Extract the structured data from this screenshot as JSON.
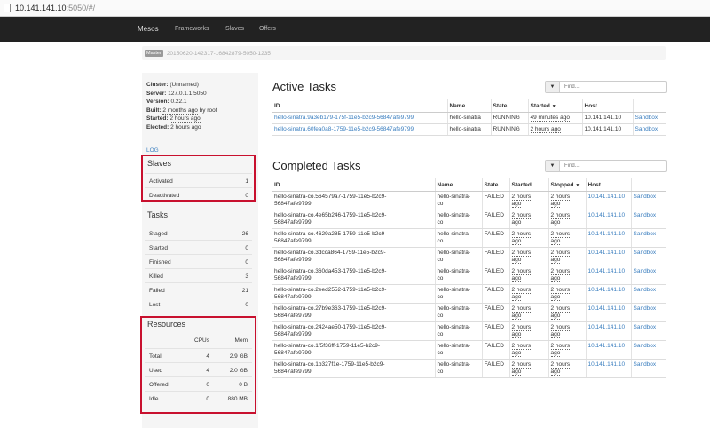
{
  "browser": {
    "url_host": "10.141.141.10",
    "url_rest": ":5050/#/"
  },
  "nav": {
    "brand": "Mesos",
    "items": [
      "Frameworks",
      "Slaves",
      "Offers"
    ]
  },
  "breadcrumb": {
    "badge": "Master",
    "id": "20150620-142317-16842879-5050-1235"
  },
  "cluster": {
    "cluster_label": "Cluster:",
    "cluster_value": "(Unnamed)",
    "server_label": "Server:",
    "server_value": "127.0.1.1:5050",
    "version_label": "Version:",
    "version_value": "0.22.1",
    "built_label": "Built:",
    "built_value": "2 months ago",
    "built_by": "by root",
    "started_label": "Started:",
    "started_value": "2 hours ago",
    "elected_label": "Elected:",
    "elected_value": "2 hours ago",
    "log_link": "LOG"
  },
  "slaves": {
    "title": "Slaves",
    "rows": [
      {
        "label": "Activated",
        "value": "1"
      },
      {
        "label": "Deactivated",
        "value": "0"
      }
    ]
  },
  "tasks_summary": {
    "title": "Tasks",
    "rows": [
      {
        "label": "Staged",
        "value": "26"
      },
      {
        "label": "Started",
        "value": "0"
      },
      {
        "label": "Finished",
        "value": "0"
      },
      {
        "label": "Killed",
        "value": "3"
      },
      {
        "label": "Failed",
        "value": "21"
      },
      {
        "label": "Lost",
        "value": "0"
      }
    ]
  },
  "resources": {
    "title": "Resources",
    "col_cpus": "CPUs",
    "col_mem": "Mem",
    "rows": [
      {
        "label": "Total",
        "cpus": "4",
        "mem": "2.9 GB"
      },
      {
        "label": "Used",
        "cpus": "4",
        "mem": "2.0 GB"
      },
      {
        "label": "Offered",
        "cpus": "0",
        "mem": "0 B"
      },
      {
        "label": "Idle",
        "cpus": "0",
        "mem": "880 MB"
      }
    ]
  },
  "active_tasks": {
    "title": "Active Tasks",
    "filter_placeholder": "Find...",
    "headers": {
      "id": "ID",
      "name": "Name",
      "state": "State",
      "started": "Started",
      "host": "Host"
    },
    "rows": [
      {
        "id": "hello-sinatra.9a3eb179-175f-11e5-b2c9-56847afe9799",
        "name": "hello-sinatra",
        "state": "RUNNING",
        "started": "49 minutes ago",
        "host": "10.141.141.10",
        "sandbox": "Sandbox"
      },
      {
        "id": "hello-sinatra.60fea0a8-1759-11e5-b2c9-56847afe9799",
        "name": "hello-sinatra",
        "state": "RUNNING",
        "started": "2 hours ago",
        "host": "10.141.141.10",
        "sandbox": "Sandbox"
      }
    ]
  },
  "completed_tasks": {
    "title": "Completed Tasks",
    "filter_placeholder": "Find...",
    "headers": {
      "id": "ID",
      "name": "Name",
      "state": "State",
      "started": "Started",
      "stopped": "Stopped",
      "host": "Host"
    },
    "rows": [
      {
        "id1": "hello-sinatra-co.564579a7-1759-11e5-b2c9-",
        "id2": "56847afe9799",
        "name1": "hello-sinatra-",
        "name2": "co",
        "state": "FAILED",
        "started1": "2 hours",
        "started2": "ago",
        "stopped1": "2 hours",
        "stopped2": "ago",
        "host": "10.141.141.10",
        "sandbox": "Sandbox"
      },
      {
        "id1": "hello-sinatra-co.4e65b246-1759-11e5-b2c9-",
        "id2": "56847afe9799",
        "name1": "hello-sinatra-",
        "name2": "co",
        "state": "FAILED",
        "started1": "2 hours",
        "started2": "ago",
        "stopped1": "2 hours",
        "stopped2": "ago",
        "host": "10.141.141.10",
        "sandbox": "Sandbox"
      },
      {
        "id1": "hello-sinatra-co.4629a285-1759-11e5-b2c9-",
        "id2": "56847afe9799",
        "name1": "hello-sinatra-",
        "name2": "co",
        "state": "FAILED",
        "started1": "2 hours",
        "started2": "ago",
        "stopped1": "2 hours",
        "stopped2": "ago",
        "host": "10.141.141.10",
        "sandbox": "Sandbox"
      },
      {
        "id1": "hello-sinatra-co.3dcca864-1759-11e5-b2c9-",
        "id2": "56847afe9799",
        "name1": "hello-sinatra-",
        "name2": "co",
        "state": "FAILED",
        "started1": "2 hours",
        "started2": "ago",
        "stopped1": "2 hours",
        "stopped2": "ago",
        "host": "10.141.141.10",
        "sandbox": "Sandbox"
      },
      {
        "id1": "hello-sinatra-co.360da453-1759-11e5-b2c9-",
        "id2": "56847afe9799",
        "name1": "hello-sinatra-",
        "name2": "co",
        "state": "FAILED",
        "started1": "2 hours",
        "started2": "ago",
        "stopped1": "2 hours",
        "stopped2": "ago",
        "host": "10.141.141.10",
        "sandbox": "Sandbox"
      },
      {
        "id1": "hello-sinatra-co.2eed2552-1759-11e5-b2c9-",
        "id2": "56847afe9799",
        "name1": "hello-sinatra-",
        "name2": "co",
        "state": "FAILED",
        "started1": "2 hours",
        "started2": "ago",
        "stopped1": "2 hours",
        "stopped2": "ago",
        "host": "10.141.141.10",
        "sandbox": "Sandbox"
      },
      {
        "id1": "hello-sinatra-co.27b9e363-1759-11e5-b2c9-",
        "id2": "56847afe9799",
        "name1": "hello-sinatra-",
        "name2": "co",
        "state": "FAILED",
        "started1": "2 hours",
        "started2": "ago",
        "stopped1": "2 hours",
        "stopped2": "ago",
        "host": "10.141.141.10",
        "sandbox": "Sandbox"
      },
      {
        "id1": "hello-sinatra-co.2424ae50-1759-11e5-b2c9-",
        "id2": "56847afe9799",
        "name1": "hello-sinatra-",
        "name2": "co",
        "state": "FAILED",
        "started1": "2 hours",
        "started2": "ago",
        "stopped1": "2 hours",
        "stopped2": "ago",
        "host": "10.141.141.10",
        "sandbox": "Sandbox"
      },
      {
        "id1": "hello-sinatra-co.1f5f36ff-1759-11e5-b2c9-",
        "id2": "56847afe9799",
        "name1": "hello-sinatra-",
        "name2": "co",
        "state": "FAILED",
        "started1": "2 hours",
        "started2": "ago",
        "stopped1": "2 hours",
        "stopped2": "ago",
        "host": "10.141.141.10",
        "sandbox": "Sandbox"
      },
      {
        "id1": "hello-sinatra-co.1b327f1e-1759-11e5-b2c9-",
        "id2": "56847afe9799",
        "name1": "hello-sinatra-",
        "name2": "co",
        "state": "FAILED",
        "started1": "2 hours",
        "started2": "ago",
        "stopped1": "2 hours",
        "stopped2": "ago",
        "host": "10.141.141.10",
        "sandbox": "Sandbox"
      }
    ]
  },
  "colors": {
    "navbar": "#222222",
    "link": "#3a7ebf",
    "highlight": "#c8102e",
    "sidebar": "#f5f5f5"
  }
}
